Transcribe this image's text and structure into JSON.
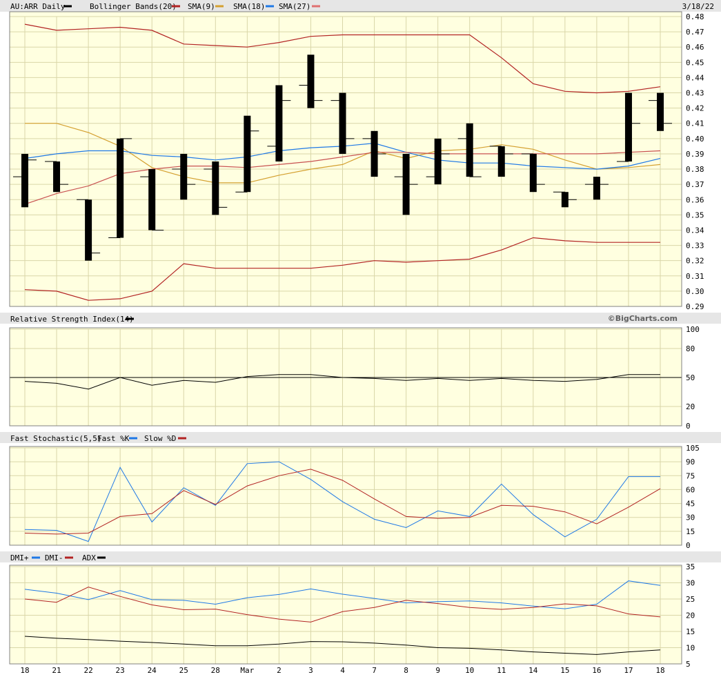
{
  "header": {
    "symbol": "AU:ARR Daily",
    "date": "3/18/22",
    "legend": [
      {
        "label": "Bollinger Bands(20)",
        "color": "#000000"
      },
      {
        "label": "SMA(9)",
        "color": "#b22222"
      },
      {
        "label": "SMA(18)",
        "color": "#d4a030"
      },
      {
        "label": "SMA(27)",
        "color": "#1e78e6"
      }
    ],
    "legend_tail_color": "#e07070"
  },
  "copyright": "©BigCharts.com",
  "colors": {
    "panel_bg": "#ffffe0",
    "header_bg": "#e6e6e6",
    "bollinger": "#b22222",
    "sma9": "#d4a030",
    "sma18": "#1e78e6",
    "sma27": "#c85050",
    "blue": "#1e78e6",
    "red": "#b22222"
  },
  "x_labels": [
    "18",
    "21",
    "22",
    "23",
    "24",
    "25",
    "28",
    "Mar",
    "2",
    "3",
    "4",
    "7",
    "8",
    "9",
    "10",
    "11",
    "14",
    "15",
    "16",
    "17",
    "18"
  ],
  "chart_data": [
    {
      "type": "ohlc",
      "title": "AU:ARR Daily",
      "ylim": [
        0.29,
        0.48
      ],
      "yticks": [
        "0.48",
        "0.47",
        "0.46",
        "0.45",
        "0.44",
        "0.43",
        "0.42",
        "0.41",
        "0.40",
        "0.39",
        "0.38",
        "0.37",
        "0.36",
        "0.35",
        "0.34",
        "0.33",
        "0.32",
        "0.31",
        "0.30",
        "0.29"
      ],
      "ohlc": [
        {
          "o": 0.375,
          "h": 0.39,
          "l": 0.355,
          "c": 0.386
        },
        {
          "o": 0.385,
          "h": 0.385,
          "l": 0.365,
          "c": 0.37
        },
        {
          "o": 0.36,
          "h": 0.36,
          "l": 0.32,
          "c": 0.325
        },
        {
          "o": 0.335,
          "h": 0.4,
          "l": 0.335,
          "c": 0.4
        },
        {
          "o": 0.375,
          "h": 0.38,
          "l": 0.34,
          "c": 0.34
        },
        {
          "o": 0.38,
          "h": 0.39,
          "l": 0.36,
          "c": 0.37
        },
        {
          "o": 0.38,
          "h": 0.385,
          "l": 0.35,
          "c": 0.355
        },
        {
          "o": 0.365,
          "h": 0.415,
          "l": 0.365,
          "c": 0.405
        },
        {
          "o": 0.395,
          "h": 0.435,
          "l": 0.385,
          "c": 0.425
        },
        {
          "o": 0.435,
          "h": 0.455,
          "l": 0.42,
          "c": 0.425
        },
        {
          "o": 0.425,
          "h": 0.43,
          "l": 0.39,
          "c": 0.4
        },
        {
          "o": 0.4,
          "h": 0.405,
          "l": 0.375,
          "c": 0.39
        },
        {
          "o": 0.375,
          "h": 0.39,
          "l": 0.35,
          "c": 0.37
        },
        {
          "o": 0.375,
          "h": 0.4,
          "l": 0.37,
          "c": 0.39
        },
        {
          "o": 0.4,
          "h": 0.41,
          "l": 0.375,
          "c": 0.375
        },
        {
          "o": 0.395,
          "h": 0.395,
          "l": 0.375,
          "c": 0.39
        },
        {
          "o": 0.39,
          "h": 0.39,
          "l": 0.365,
          "c": 0.37
        },
        {
          "o": 0.365,
          "h": 0.365,
          "l": 0.355,
          "c": 0.36
        },
        {
          "o": 0.37,
          "h": 0.375,
          "l": 0.36,
          "c": 0.37
        },
        {
          "o": 0.385,
          "h": 0.43,
          "l": 0.385,
          "c": 0.41
        },
        {
          "o": 0.425,
          "h": 0.43,
          "l": 0.405,
          "c": 0.41
        }
      ],
      "series": [
        {
          "values": [
            0.475,
            0.471,
            0.472,
            0.473,
            0.471,
            0.462,
            0.461,
            0.46,
            0.463,
            0.467,
            0.468,
            0.468,
            0.468,
            0.468,
            0.468,
            0.453,
            0.436,
            0.431,
            0.43,
            0.431,
            0.434
          ],
          "color_key": "bollinger"
        },
        {
          "values": [
            0.301,
            0.3,
            0.294,
            0.295,
            0.3,
            0.318,
            0.315,
            0.315,
            0.315,
            0.315,
            0.317,
            0.32,
            0.319,
            0.32,
            0.321,
            0.327,
            0.335,
            0.333,
            0.332,
            0.332,
            0.332
          ],
          "color_key": "bollinger"
        },
        {
          "values": [
            0.41,
            0.41,
            0.404,
            0.395,
            0.381,
            0.375,
            0.371,
            0.371,
            0.376,
            0.38,
            0.383,
            0.392,
            0.387,
            0.392,
            0.393,
            0.396,
            0.393,
            0.386,
            0.38,
            0.381,
            0.383
          ],
          "color_key": "sma9"
        },
        {
          "values": [
            0.387,
            0.39,
            0.392,
            0.392,
            0.389,
            0.388,
            0.386,
            0.388,
            0.392,
            0.394,
            0.395,
            0.397,
            0.391,
            0.386,
            0.384,
            0.384,
            0.382,
            0.381,
            0.38,
            0.382,
            0.387
          ],
          "color_key": "sma18"
        },
        {
          "values": [
            0.357,
            0.364,
            0.369,
            0.377,
            0.38,
            0.382,
            0.382,
            0.381,
            0.383,
            0.385,
            0.388,
            0.391,
            0.391,
            0.39,
            0.39,
            0.39,
            0.39,
            0.39,
            0.39,
            0.391,
            0.392
          ],
          "color_key": "sma27"
        }
      ]
    },
    {
      "type": "line",
      "title": "Relative Strength Index(14)",
      "title_color": "#000000",
      "ylim": [
        0,
        100
      ],
      "yticks": [
        "100",
        "80",
        "50",
        "20",
        "0"
      ],
      "refline": 50,
      "series": [
        {
          "name": "Relative Strength Index(14)",
          "values": [
            46,
            44,
            38,
            50,
            42,
            47,
            45,
            51,
            53,
            53,
            50,
            49,
            47,
            49,
            47,
            49,
            47,
            46,
            48,
            53,
            53
          ],
          "color_key": "black"
        }
      ]
    },
    {
      "type": "line",
      "title": "Fast Stochastic(5,5)",
      "ylim": [
        0,
        105
      ],
      "yticks": [
        "105",
        "90",
        "75",
        "60",
        "45",
        "30",
        "15",
        "0"
      ],
      "series": [
        {
          "name": "Fast %K",
          "values": [
            17,
            16,
            4,
            84,
            25,
            62,
            43,
            88,
            90,
            71,
            47,
            28,
            19,
            37,
            31,
            66,
            33,
            9,
            28,
            74,
            74
          ],
          "color_key": "blue"
        },
        {
          "name": "Slow %D",
          "values": [
            13,
            12,
            13,
            31,
            34,
            59,
            44,
            64,
            75,
            82,
            70,
            50,
            31,
            29,
            30,
            43,
            42,
            36,
            23,
            41,
            61
          ],
          "color_key": "red"
        }
      ]
    },
    {
      "type": "line",
      "title": "",
      "ylim": [
        5,
        35
      ],
      "yticks": [
        "35",
        "30",
        "25",
        "20",
        "15",
        "10",
        "5"
      ],
      "series": [
        {
          "name": "DMI+",
          "values": [
            28,
            26.8,
            24.8,
            27.6,
            24.8,
            24.6,
            23.4,
            25.4,
            26.4,
            28.1,
            26.5,
            25.2,
            23.8,
            24.2,
            24.4,
            23.8,
            22.8,
            22,
            23.4,
            30.6,
            29.2
          ],
          "color_key": "blue"
        },
        {
          "name": "DMI-",
          "values": [
            25,
            24,
            28.7,
            25.8,
            23.2,
            21.7,
            21.9,
            20.2,
            18.8,
            17.9,
            21.1,
            22.4,
            24.6,
            23.6,
            22.4,
            21.8,
            22.4,
            23.5,
            22.9,
            20.4,
            19.5
          ],
          "color_key": "red"
        },
        {
          "name": "ADX",
          "values": [
            13.5,
            12.9,
            12.5,
            12,
            11.6,
            11.1,
            10.6,
            10.6,
            11.1,
            11.9,
            11.8,
            11.4,
            10.8,
            10,
            9.8,
            9.3,
            8.7,
            8.3,
            7.9,
            8.7,
            9.3
          ],
          "color_key": "black"
        }
      ]
    }
  ]
}
